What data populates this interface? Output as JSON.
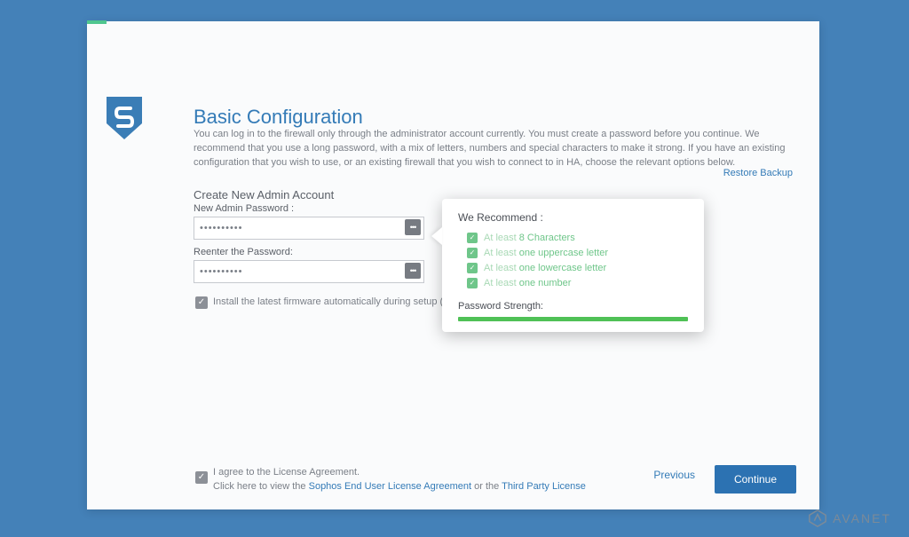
{
  "header": {
    "title": "Basic Configuration",
    "description": "You can log in to the firewall only through the administrator account currently. You must create a password before you continue. We recommend that you use a long password, with a mix of letters, numbers and special characters to make it strong. If you have an existing configuration that you wish to use, or an existing firewall that you wish to connect to in HA, choose the relevant options below.",
    "restore_link": "Restore Backup"
  },
  "form": {
    "section_heading": "Create New Admin Account",
    "new_password_label": "New Admin Password :",
    "new_password_value": "••••••••••",
    "reenter_label": "Reenter the Password:",
    "reenter_value": "••••••••••",
    "firmware_label": "Install the latest firmware automatically during setup (re"
  },
  "tooltip": {
    "title": "We Recommend :",
    "requirements": [
      {
        "prefix": "At least",
        "text": "8 Characters"
      },
      {
        "prefix": "At least",
        "text": "one uppercase letter"
      },
      {
        "prefix": "At least",
        "text": "one lowercase letter"
      },
      {
        "prefix": "At least",
        "text": "one number"
      }
    ],
    "strength_label": "Password Strength:"
  },
  "footer": {
    "license_agree": "I agree to the License Agreement.",
    "license_click": "Click here to view the ",
    "license_link1": "Sophos End User License Agreement",
    "license_or": " or the ",
    "license_link2": "Third Party License",
    "previous": "Previous",
    "continue": "Continue"
  },
  "watermark": {
    "text": "AVANET"
  }
}
